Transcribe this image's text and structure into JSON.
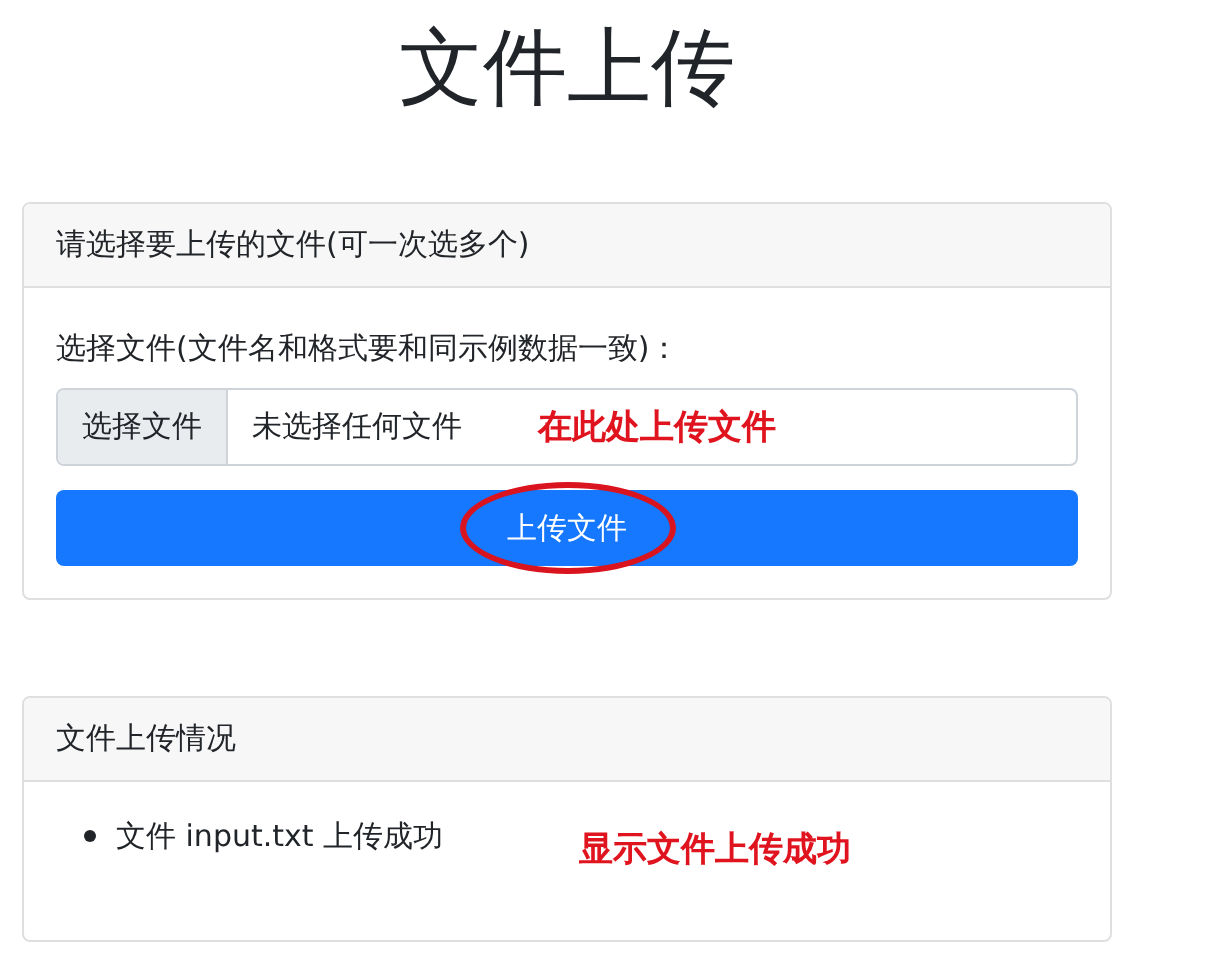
{
  "page_title": "文件上传",
  "upload_card": {
    "header": "请选择要上传的文件(可一次选多个)",
    "field_label": "选择文件(文件名和格式要和同示例数据一致)：",
    "file_button": "选择文件",
    "file_status": "未选择任何文件",
    "field_annotation": "在此处上传文件",
    "submit_button": "上传文件",
    "submit_circled": true
  },
  "result_card": {
    "header": "文件上传情况",
    "items": [
      "文件 input.txt 上传成功"
    ],
    "annotation": "显示文件上传成功"
  }
}
